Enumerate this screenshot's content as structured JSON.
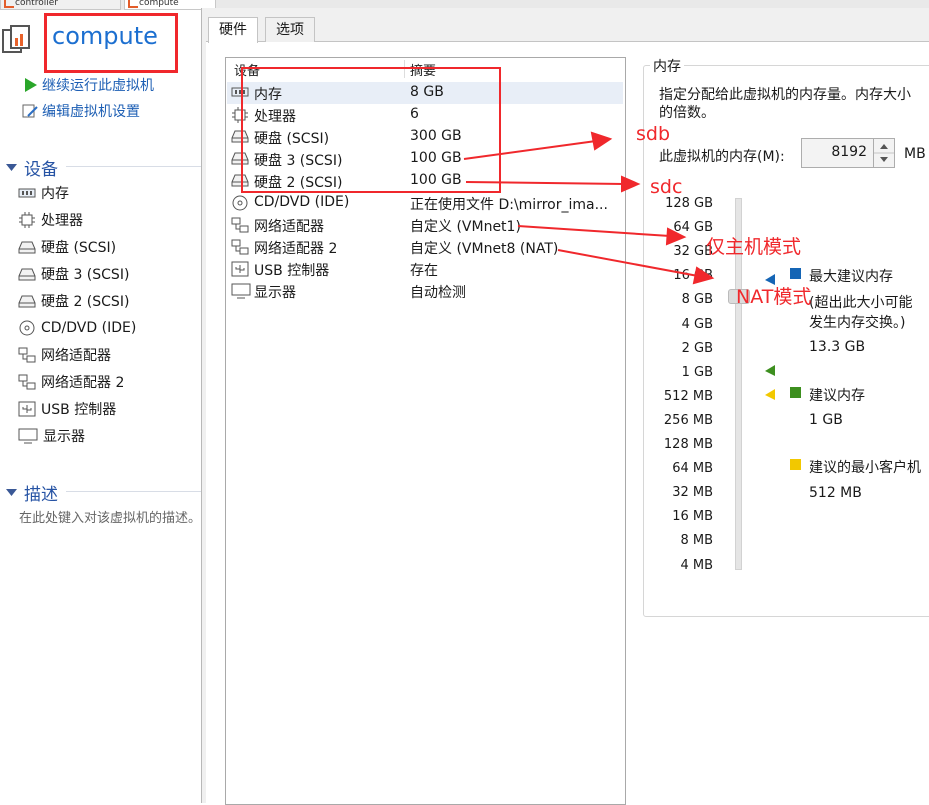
{
  "top_tabs": [
    {
      "label": "controller"
    },
    {
      "label": "compute"
    }
  ],
  "vm": {
    "title": "compute"
  },
  "actions": [
    {
      "label": "继续运行此虚拟机",
      "icon": "play-icon"
    },
    {
      "label": "编辑虚拟机设置",
      "icon": "edit-settings-icon"
    }
  ],
  "sections": {
    "devices": "设备",
    "description": "描述",
    "description_placeholder": "在此处键入对该虚拟机的描述。"
  },
  "sidebar_devices": [
    {
      "label": "内存",
      "icon": "memory-icon"
    },
    {
      "label": "处理器",
      "icon": "cpu-icon"
    },
    {
      "label": "硬盘 (SCSI)",
      "icon": "hard-disk-icon"
    },
    {
      "label": "硬盘 3 (SCSI)",
      "icon": "hard-disk-icon"
    },
    {
      "label": "硬盘 2 (SCSI)",
      "icon": "hard-disk-icon"
    },
    {
      "label": "CD/DVD (IDE)",
      "icon": "cd-dvd-icon"
    },
    {
      "label": "网络适配器",
      "icon": "network-adapter-icon"
    },
    {
      "label": "网络适配器 2",
      "icon": "network-adapter-icon"
    },
    {
      "label": "USB 控制器",
      "icon": "usb-icon"
    },
    {
      "label": "显示器",
      "icon": "display-icon"
    }
  ],
  "dialog": {
    "tabs": [
      {
        "label": "硬件"
      },
      {
        "label": "选项"
      }
    ],
    "columns": {
      "device": "设备",
      "summary": "摘要"
    },
    "devices": [
      {
        "name": "内存",
        "summary": "8 GB",
        "icon": "memory-icon"
      },
      {
        "name": "处理器",
        "summary": "6",
        "icon": "cpu-icon"
      },
      {
        "name": "硬盘 (SCSI)",
        "summary": "300 GB",
        "icon": "hard-disk-icon"
      },
      {
        "name": "硬盘 3 (SCSI)",
        "summary": "100 GB",
        "icon": "hard-disk-icon"
      },
      {
        "name": "硬盘 2 (SCSI)",
        "summary": "100 GB",
        "icon": "hard-disk-icon"
      },
      {
        "name": "CD/DVD (IDE)",
        "summary": "正在使用文件 D:\\mirror_ima...",
        "icon": "cd-dvd-icon"
      },
      {
        "name": "网络适配器",
        "summary": "自定义 (VMnet1)",
        "icon": "network-adapter-icon"
      },
      {
        "name": "网络适配器 2",
        "summary": "自定义 (VMnet8 (NAT)",
        "icon": "network-adapter-icon"
      },
      {
        "name": "USB 控制器",
        "summary": "存在",
        "icon": "usb-icon"
      },
      {
        "name": "显示器",
        "summary": "自动检测",
        "icon": "display-icon"
      }
    ],
    "memory": {
      "group_label": "内存",
      "description_line1": "指定分配给此虚拟机的内存量。内存大小",
      "description_line2": "的倍数。",
      "field_label": "此虚拟机的内存(M):",
      "field_value": "8192",
      "unit": "MB",
      "scale_labels": [
        "128 GB",
        "64 GB",
        "32 GB",
        "16 GB",
        "8 GB",
        "4 GB",
        "2 GB",
        "1 GB",
        "512 MB",
        "256 MB",
        "128 MB",
        "64 MB",
        "32 MB",
        "16 MB",
        "8 MB",
        "4 MB"
      ],
      "legend": {
        "max_title": "最大建议内存",
        "max_note_line1": "(超出此大小可能",
        "max_note_line2": "发生内存交换。)",
        "max_value": "13.3 GB",
        "recommended_title": "建议内存",
        "recommended_value": "1 GB",
        "min_title": "建议的最小客户机",
        "min_value": "512 MB"
      },
      "colors": {
        "max": "#1565b5",
        "recommended": "#3d8f1f",
        "min": "#f2c800"
      }
    }
  },
  "annotations": {
    "sdb": "sdb",
    "sdc": "sdc",
    "host_only": "仅主机模式",
    "nat": "NAT模式",
    "color": "#f0282c"
  }
}
